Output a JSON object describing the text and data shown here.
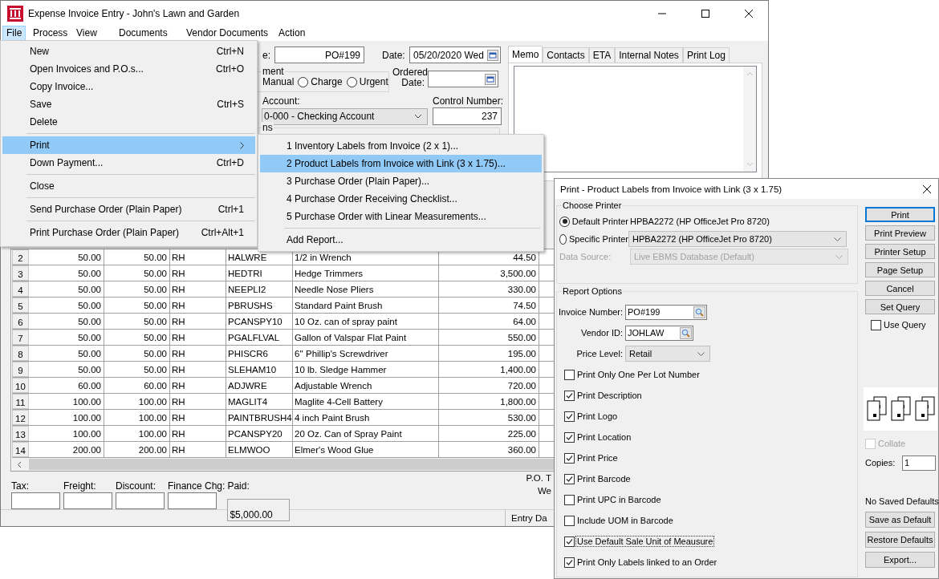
{
  "window": {
    "title": "Expense Invoice Entry - John's Lawn and Garden"
  },
  "menubar": [
    {
      "label": "File",
      "selected": true
    },
    {
      "label": "Process",
      "selected": false
    },
    {
      "label": "View",
      "selected": false
    },
    {
      "label": "Documents",
      "selected": false
    },
    {
      "label": "Vendor Documents",
      "selected": false
    },
    {
      "label": "Action",
      "selected": false
    }
  ],
  "file_menu": [
    {
      "kind": "item",
      "label": "New",
      "shortcut": "Ctrl+N",
      "selected": false
    },
    {
      "kind": "item",
      "label": "Open Invoices and P.O.s...",
      "shortcut": "Ctrl+O",
      "selected": false
    },
    {
      "kind": "item",
      "label": "Copy Invoice...",
      "selected": false
    },
    {
      "kind": "item",
      "label": "Save",
      "shortcut": "Ctrl+S",
      "selected": false
    },
    {
      "kind": "item",
      "label": "Delete",
      "selected": false
    },
    {
      "kind": "separator"
    },
    {
      "kind": "submenu",
      "label": "Print",
      "selected": true
    },
    {
      "kind": "item",
      "label": "Down Payment...",
      "shortcut": "Ctrl+D",
      "selected": false
    },
    {
      "kind": "separator"
    },
    {
      "kind": "item",
      "label": "Close",
      "selected": false
    },
    {
      "kind": "separator"
    },
    {
      "kind": "item",
      "label": "Send Purchase Order (Plain Paper)",
      "shortcut": "Ctrl+1",
      "selected": false
    },
    {
      "kind": "separator"
    },
    {
      "kind": "item",
      "label": "Print Purchase Order (Plain Paper)",
      "shortcut": "Ctrl+Alt+1",
      "selected": false
    }
  ],
  "print_submenu": [
    {
      "kind": "item",
      "label": "1 Inventory Labels from Invoice (2 x 1)...",
      "selected": false
    },
    {
      "kind": "item",
      "label": "2 Product Labels from Invoice with Link (3 x 1.75)...",
      "selected": true
    },
    {
      "kind": "item",
      "label": "3 Purchase Order (Plain Paper)...",
      "selected": false
    },
    {
      "kind": "item",
      "label": "4 Purchase Order Receiving Checklist...",
      "selected": false
    },
    {
      "kind": "item",
      "label": "5 Purchase Order with Linear Measurements...",
      "selected": false
    },
    {
      "kind": "separator"
    },
    {
      "kind": "item",
      "label": "Add Report...",
      "selected": false
    }
  ],
  "form": {
    "invoice_label": "e:",
    "invoice_value": "PO#199",
    "date_label": "Date:",
    "date_value": "05/20/2020 Wed",
    "payment_legend": "ment",
    "manual_label": "Manual",
    "payment_radios": [
      {
        "label": "Charge",
        "selected": false
      },
      {
        "label": "Urgent",
        "selected": false
      }
    ],
    "ordered_date_label": "Ordered Date:",
    "account_label": "Account:",
    "account_value": "0-000 - Checking Account",
    "control_number_label": "Control Number:",
    "control_number": "237",
    "section_legend": "ns"
  },
  "notes_tabs": [
    {
      "label": "Memo",
      "selected": true
    },
    {
      "label": "Contacts",
      "selected": false
    },
    {
      "label": "ETA",
      "selected": false
    },
    {
      "label": "Internal Notes",
      "selected": false
    },
    {
      "label": "Print Log",
      "selected": false
    }
  ],
  "table": {
    "rows": [
      {
        "num": "2",
        "cells": [
          "50.00",
          "50.00",
          "RH",
          "HALWRE",
          "1/2 in Wrench",
          "44.50"
        ]
      },
      {
        "num": "3",
        "cells": [
          "50.00",
          "50.00",
          "RH",
          "HEDTRI",
          "Hedge Trimmers",
          "3,500.00"
        ]
      },
      {
        "num": "4",
        "cells": [
          "50.00",
          "50.00",
          "RH",
          "NEEPLI2",
          "Needle Nose Pliers",
          "330.00"
        ]
      },
      {
        "num": "5",
        "cells": [
          "50.00",
          "50.00",
          "RH",
          "PBRUSHS",
          "Standard Paint Brush",
          "74.50"
        ]
      },
      {
        "num": "6",
        "cells": [
          "50.00",
          "50.00",
          "RH",
          "PCANSPY10",
          "10 Oz. can of spray paint",
          "64.00"
        ]
      },
      {
        "num": "7",
        "cells": [
          "50.00",
          "50.00",
          "RH",
          "PGALFLVAL",
          "Gallon of Valspar Flat Paint",
          "550.00"
        ]
      },
      {
        "num": "8",
        "cells": [
          "50.00",
          "50.00",
          "RH",
          "PHISCR6",
          "6'' Phillip's Screwdriver",
          "195.00"
        ]
      },
      {
        "num": "9",
        "cells": [
          "50.00",
          "50.00",
          "RH",
          "SLEHAM10",
          "10 lb. Sledge Hammer",
          "1,400.00"
        ]
      },
      {
        "num": "10",
        "cells": [
          "60.00",
          "60.00",
          "RH",
          "ADJWRE",
          "Adjustable Wrench",
          "720.00"
        ]
      },
      {
        "num": "11",
        "cells": [
          "100.00",
          "100.00",
          "RH",
          "MAGLIT4",
          "Maglite 4-Cell Battery",
          "1,800.00"
        ]
      },
      {
        "num": "12",
        "cells": [
          "100.00",
          "100.00",
          "RH",
          "PAINTBRUSH4",
          "4 inch Paint Brush",
          "530.00"
        ]
      },
      {
        "num": "13",
        "cells": [
          "100.00",
          "100.00",
          "RH",
          "PCANSPY20",
          "20 Oz. Can of Spray Paint",
          "225.00"
        ]
      },
      {
        "num": "14",
        "cells": [
          "200.00",
          "200.00",
          "RH",
          "ELMWOO",
          "Elmer's Wood Glue",
          "360.00"
        ]
      }
    ]
  },
  "charges": [
    {
      "label": "Tax:"
    },
    {
      "label": "Freight:"
    },
    {
      "label": "Discount:"
    },
    {
      "label": "Finance Chg:"
    },
    {
      "label": "Paid:",
      "value": "$5,000.00"
    }
  ],
  "po_total_label": "P.O. T",
  "po_total_label_2": "We",
  "status_bar": {
    "entry_label": "Entry Da"
  },
  "dialog": {
    "title": "Print - Product Labels from Invoice with Link (3 x 1.75)",
    "choose_printer_legend": "Choose Printer",
    "printer_radios": [
      {
        "label": "Default Printer",
        "selected": true,
        "value": "HPBA2272 (HP OfficeJet Pro 8720)"
      },
      {
        "label": "Specific Printer",
        "selected": false,
        "value": "HPBA2272 (HP OfficeJet Pro 8720)"
      }
    ],
    "data_source": {
      "label": "Data Source:",
      "value": "Live EBMS Database (Default)",
      "disabled": true
    },
    "report_options_legend": "Report Options",
    "invoice_number_label": "Invoice Number:",
    "invoice_number": "PO#199",
    "vendor_id_label": "Vendor ID:",
    "vendor_id": "JOHLAW",
    "price_level_label": "Price Level:",
    "price_level": "Retail",
    "options": [
      {
        "label": "Print Only One Per Lot Number",
        "checked": false,
        "focused": false
      },
      {
        "label": "Print Description",
        "checked": true,
        "focused": false
      },
      {
        "label": "Print Logo",
        "checked": true,
        "focused": false
      },
      {
        "label": "Print Location",
        "checked": true,
        "focused": false
      },
      {
        "label": "Print Price",
        "checked": true,
        "focused": false
      },
      {
        "label": "Print Barcode",
        "checked": true,
        "focused": false
      },
      {
        "label": "Print UPC in Barcode",
        "checked": false,
        "focused": false
      },
      {
        "label": "Include UOM in Barcode",
        "checked": false,
        "focused": false
      },
      {
        "label": "Use Default Sale Unit of Meausure",
        "checked": true,
        "focused": true
      },
      {
        "label": "Print Only Labels linked to an Order",
        "checked": true,
        "focused": false
      }
    ],
    "buttons": [
      {
        "label": "Print",
        "default": true
      },
      {
        "label": "Print Preview",
        "default": false
      },
      {
        "label": "Printer Setup",
        "default": false
      },
      {
        "label": "Page Setup",
        "default": false
      },
      {
        "label": "Cancel",
        "default": false
      },
      {
        "label": "Set Query",
        "default": false
      }
    ],
    "use_query": {
      "label": "Use Query",
      "checked": false
    },
    "collate": {
      "label": "Collate",
      "checked": false,
      "disabled": true
    },
    "copies_label": "Copies:",
    "copies": "1",
    "defaults_status": "No Saved Defaults",
    "bottom_buttons": [
      {
        "label": "Save as Default"
      },
      {
        "label": "Restore Defaults"
      },
      {
        "label": "Export..."
      }
    ]
  }
}
